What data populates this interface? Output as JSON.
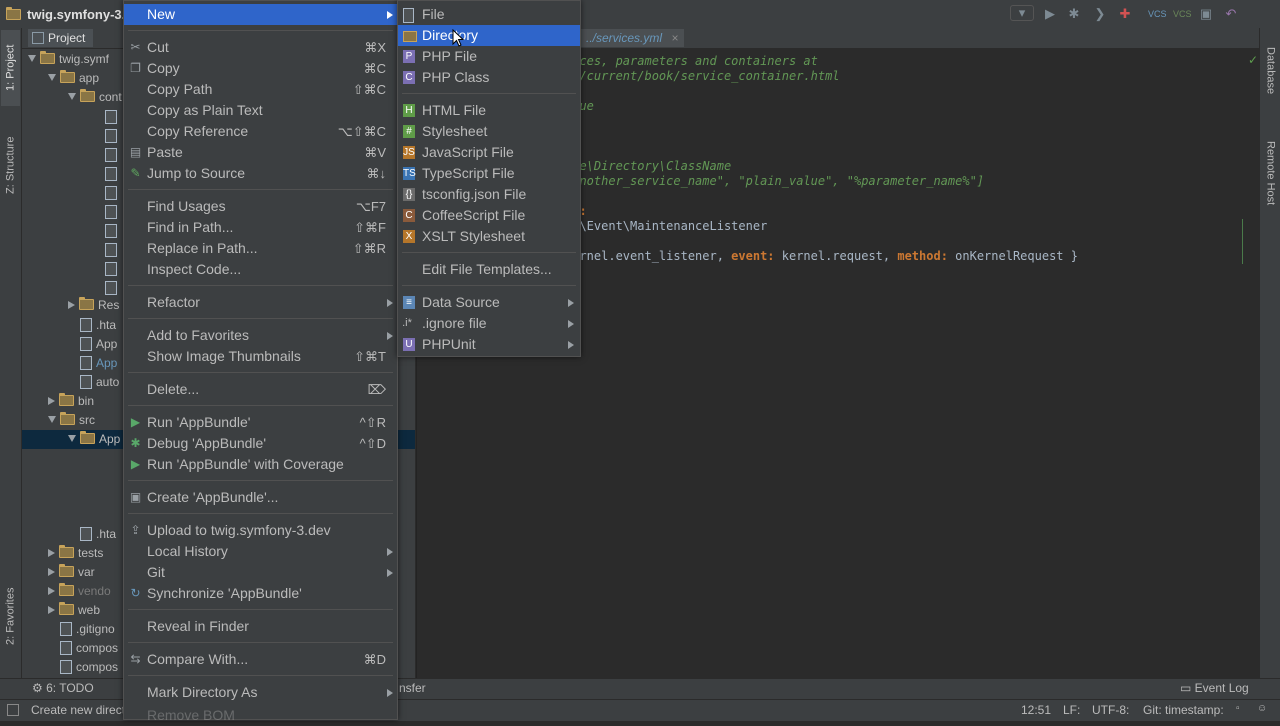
{
  "window": {
    "crumb_project": "twig.symfony-3.d"
  },
  "toolbar": {
    "icons": [
      "dropdown-icon",
      "run-icon",
      "debug-icon",
      "coverage-icon",
      "vcs-update-icon",
      "vcs-commit-icon",
      "vcs-push-icon",
      "settings-icon",
      "undo-icon"
    ]
  },
  "left_tabs": {
    "project": "1: Project",
    "structure": "Z: Structure",
    "favorites": "2: Favorites"
  },
  "right_tabs": {
    "database": "Database",
    "remote_host": "Remote Host"
  },
  "project_panel": {
    "tab_label": "Project",
    "rows": [
      {
        "label": "twig.symf",
        "depth": 0,
        "open": true
      },
      {
        "label": "app",
        "depth": 1,
        "open": true
      },
      {
        "label": "cont",
        "depth": 2,
        "open": true
      },
      {
        "label": "Res",
        "depth": 2,
        "open": false
      },
      {
        "label": ".hta",
        "depth": 2
      },
      {
        "label": "App",
        "depth": 2
      },
      {
        "label": "App",
        "depth": 2
      },
      {
        "label": "auto",
        "depth": 2
      },
      {
        "label": "bin",
        "depth": 1,
        "open": false
      },
      {
        "label": "src",
        "depth": 1,
        "open": true
      },
      {
        "label": "App",
        "depth": 2,
        "open": true
      },
      {
        "label": ".hta",
        "depth": 2
      },
      {
        "label": "tests",
        "depth": 1,
        "open": false
      },
      {
        "label": "var",
        "depth": 1,
        "open": false
      },
      {
        "label": "vendo",
        "depth": 1,
        "open": false
      },
      {
        "label": "web",
        "depth": 1,
        "open": false
      },
      {
        "label": ".gitigno",
        "depth": 1
      },
      {
        "label": "compos",
        "depth": 1
      },
      {
        "label": "compos",
        "depth": 1
      }
    ]
  },
  "editor": {
    "tab": "../services.yml",
    "lines": [
      {
        "kind": "cmt",
        "text": "vices, parameters and containers at"
      },
      {
        "kind": "cmt",
        "text": "oc/current/book/service_container.html"
      },
      {
        "kind": "cmt",
        "text": "alue"
      },
      {
        "kind": "cmt",
        "text": "dle\\Directory\\ClassName"
      },
      {
        "kind": "cmt",
        "text": "@another_service_name\", \"plain_value\", \"%parameter_name%\"]"
      },
      {
        "kind": "key",
        "text": "er:"
      },
      {
        "kind": "txt",
        "text": "le\\Event\\MaintenanceListener"
      }
    ],
    "tag_line": {
      "a": "kernel.event_listener, ",
      "b": "event:",
      "c": " kernel.request, ",
      "d": "method:",
      "e": " onKernelRequest }"
    }
  },
  "context_menu": {
    "items": [
      {
        "label": "New",
        "shortcut": "",
        "submenu": true,
        "selected": true
      },
      {
        "label": "Cut",
        "shortcut": "⌘X",
        "icon": "scissors-icon"
      },
      {
        "label": "Copy",
        "shortcut": "⌘C",
        "icon": "copy-icon"
      },
      {
        "label": "Copy Path",
        "shortcut": "⇧⌘C"
      },
      {
        "label": "Copy as Plain Text",
        "shortcut": ""
      },
      {
        "label": "Copy Reference",
        "shortcut": "⌥⇧⌘C"
      },
      {
        "label": "Paste",
        "shortcut": "⌘V",
        "icon": "clipboard-icon"
      },
      {
        "label": "Jump to Source",
        "shortcut": "⌘↓",
        "icon": "pencil-icon"
      },
      {
        "label": "Find Usages",
        "shortcut": "⌥F7"
      },
      {
        "label": "Find in Path...",
        "shortcut": "⇧⌘F"
      },
      {
        "label": "Replace in Path...",
        "shortcut": "⇧⌘R"
      },
      {
        "label": "Inspect Code...",
        "shortcut": ""
      },
      {
        "label": "Refactor",
        "shortcut": "",
        "submenu": true
      },
      {
        "label": "Add to Favorites",
        "shortcut": "",
        "submenu": true
      },
      {
        "label": "Show Image Thumbnails",
        "shortcut": "⇧⌘T"
      },
      {
        "label": "Delete...",
        "shortcut": "⌦"
      },
      {
        "label": "Run 'AppBundle'",
        "shortcut": "^⇧R",
        "icon": "run-icon"
      },
      {
        "label": "Debug 'AppBundle'",
        "shortcut": "^⇧D",
        "icon": "debug-icon"
      },
      {
        "label": "Run 'AppBundle' with Coverage",
        "shortcut": "",
        "icon": "coverage-icon"
      },
      {
        "label": "Create 'AppBundle'...",
        "shortcut": "",
        "icon": "create-icon"
      },
      {
        "label": "Upload to twig.symfony-3.dev",
        "shortcut": "",
        "icon": "upload-icon"
      },
      {
        "label": "Local History",
        "shortcut": "",
        "submenu": true
      },
      {
        "label": "Git",
        "shortcut": "",
        "submenu": true
      },
      {
        "label": "Synchronize 'AppBundle'",
        "shortcut": "",
        "icon": "sync-icon"
      },
      {
        "label": "Reveal in Finder",
        "shortcut": ""
      },
      {
        "label": "Compare With...",
        "shortcut": "⌘D",
        "icon": "compare-icon"
      },
      {
        "label": "Mark Directory As",
        "shortcut": "",
        "submenu": true
      },
      {
        "label": "Remove BOM",
        "shortcut": ""
      }
    ]
  },
  "new_submenu": {
    "items": [
      {
        "label": "File",
        "icon": "file-icon"
      },
      {
        "label": "Directory",
        "icon": "folder-icon",
        "selected": true
      },
      {
        "label": "PHP File",
        "icon": "php-file-icon"
      },
      {
        "label": "PHP Class",
        "icon": "php-class-icon"
      },
      {
        "label": "HTML File",
        "icon": "html-icon"
      },
      {
        "label": "Stylesheet",
        "icon": "css-icon"
      },
      {
        "label": "JavaScript File",
        "icon": "js-icon"
      },
      {
        "label": "TypeScript File",
        "icon": "ts-icon"
      },
      {
        "label": "tsconfig.json File",
        "icon": "tsconfig-icon"
      },
      {
        "label": "CoffeeScript File",
        "icon": "coffee-icon"
      },
      {
        "label": "XSLT Stylesheet",
        "icon": "xslt-icon"
      },
      {
        "label": "Edit File Templates...",
        "icon": ""
      },
      {
        "label": "Data Source",
        "icon": "datasource-icon",
        "submenu": true
      },
      {
        "label": ".ignore file",
        "icon": "ignore-icon",
        "submenu": true
      },
      {
        "label": "PHPUnit",
        "icon": "phpunit-icon",
        "submenu": true
      }
    ]
  },
  "bottom": {
    "todo": "6: TODO",
    "transfer": "nsfer",
    "event_log": "Event Log"
  },
  "status": {
    "message": "Create new direct",
    "time": "12:51",
    "line_sep": "LF:",
    "encoding": "UTF-8:",
    "git": "Git: timestamp:"
  }
}
